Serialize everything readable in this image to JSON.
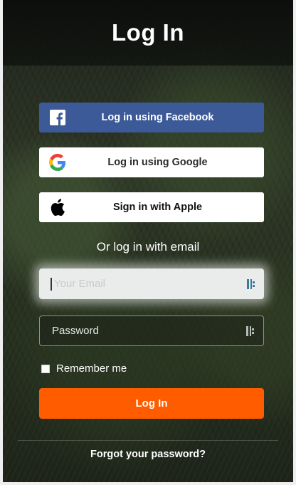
{
  "header": {
    "title": "Log In"
  },
  "social": {
    "facebook": {
      "label": "Log in using Facebook",
      "icon": "facebook-icon",
      "color": "#3c5a98"
    },
    "google": {
      "label": "Log in using Google",
      "icon": "google-icon"
    },
    "apple": {
      "label": "Sign in with Apple",
      "icon": "apple-icon"
    }
  },
  "divider_text": "Or log in with email",
  "form": {
    "email": {
      "placeholder": "Your Email",
      "value": ""
    },
    "password": {
      "placeholder": "Password",
      "value": ""
    },
    "remember": {
      "label": "Remember me",
      "checked": false
    },
    "submit_label": "Log In",
    "submit_color": "#ff5c00"
  },
  "footer": {
    "forgot_label": "Forgot your password?"
  }
}
